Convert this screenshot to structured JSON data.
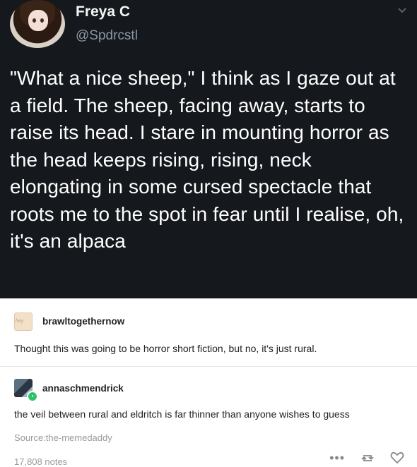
{
  "tweet": {
    "name": "Freya C",
    "handle": "@Spdrcstl",
    "text": "\"What a nice sheep,\" I think as I gaze out at a field. The sheep, facing away, starts to raise its head. I stare in mounting horror as the head keeps rising, rising, neck elongating in some cursed spectacle that roots me to the spot in fear until I realise, oh, it's an alpaca"
  },
  "comments": [
    {
      "username": "brawltogethernow",
      "avatar_text": "hey",
      "text": "Thought this was going to be horror short fiction, but no, it's just rural."
    },
    {
      "username": "annaschmendrick",
      "text": "the veil between rural and eldritch is far thinner than anyone wishes to guess"
    }
  ],
  "source": "Source:the-memedaddy",
  "notes": "17,808 notes",
  "icons": {
    "more": "more-dots-icon",
    "reblog": "reblog-icon",
    "like": "heart-icon",
    "chevron": "chevron-down-icon"
  },
  "colors": {
    "tweet_bg": "#15181c",
    "handle": "#8b98a5",
    "online_badge": "#2ec26a"
  }
}
